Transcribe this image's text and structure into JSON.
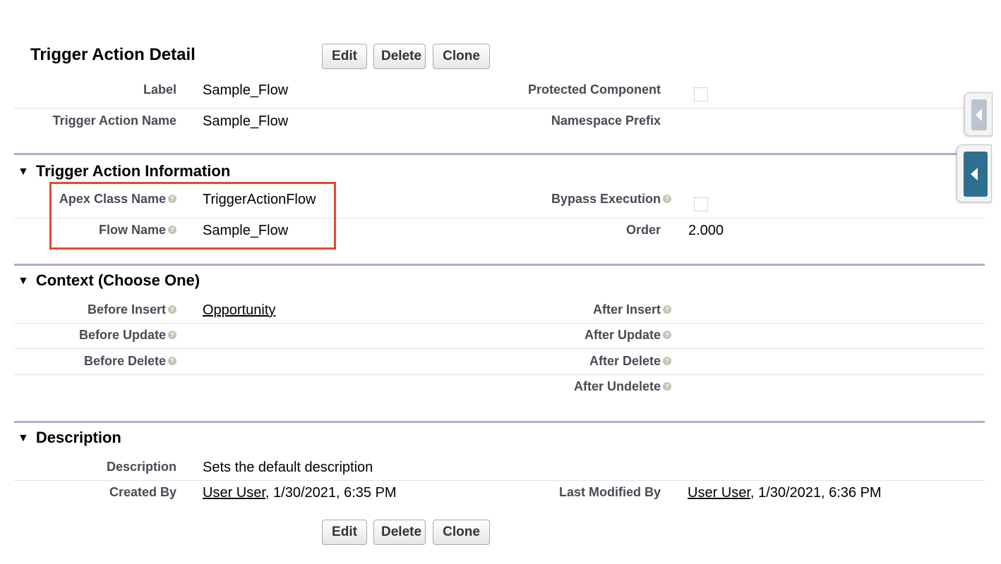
{
  "header": {
    "title": "Trigger Action Detail",
    "buttons": {
      "edit": "Edit",
      "delete": "Delete",
      "clone": "Clone"
    }
  },
  "detail": {
    "label": {
      "label": "Label",
      "value": "Sample_Flow"
    },
    "protected_component": {
      "label": "Protected Component",
      "checked": false
    },
    "trigger_action_name": {
      "label": "Trigger Action Name",
      "value": "Sample_Flow"
    },
    "namespace_prefix": {
      "label": "Namespace Prefix",
      "value": ""
    }
  },
  "trigger_action_information": {
    "title": "Trigger Action Information",
    "apex_class_name": {
      "label": "Apex Class Name",
      "value": "TriggerActionFlow"
    },
    "bypass_execution": {
      "label": "Bypass Execution",
      "checked": false
    },
    "flow_name": {
      "label": "Flow Name",
      "value": "Sample_Flow"
    },
    "order": {
      "label": "Order",
      "value": "2.000"
    }
  },
  "context": {
    "title": "Context (Choose One)",
    "before_insert": {
      "label": "Before Insert",
      "value": "Opportunity"
    },
    "after_insert": {
      "label": "After Insert",
      "value": ""
    },
    "before_update": {
      "label": "Before Update",
      "value": ""
    },
    "after_update": {
      "label": "After Update",
      "value": ""
    },
    "before_delete": {
      "label": "Before Delete",
      "value": ""
    },
    "after_delete": {
      "label": "After Delete",
      "value": ""
    },
    "after_undelete": {
      "label": "After Undelete",
      "value": ""
    }
  },
  "description_section": {
    "title": "Description",
    "description": {
      "label": "Description",
      "value": "Sets the default description"
    },
    "created_by": {
      "label": "Created By",
      "user": "User User",
      "date": ", 1/30/2021, 6:35 PM"
    },
    "last_modified_by": {
      "label": "Last Modified By",
      "user": "User User",
      "date": ", 1/30/2021, 6:36 PM"
    }
  },
  "footer": {
    "buttons": {
      "edit": "Edit",
      "delete": "Delete",
      "clone": "Clone"
    }
  },
  "icons": {
    "help": "help-icon",
    "collapse": "collapse-triangle-icon",
    "sidebar_toggle": "chevron-left-icon"
  },
  "colors": {
    "section_rule": "#a4b3c8",
    "highlight_box": "#e04a32",
    "side_tab_active": "#2f6f8f"
  }
}
